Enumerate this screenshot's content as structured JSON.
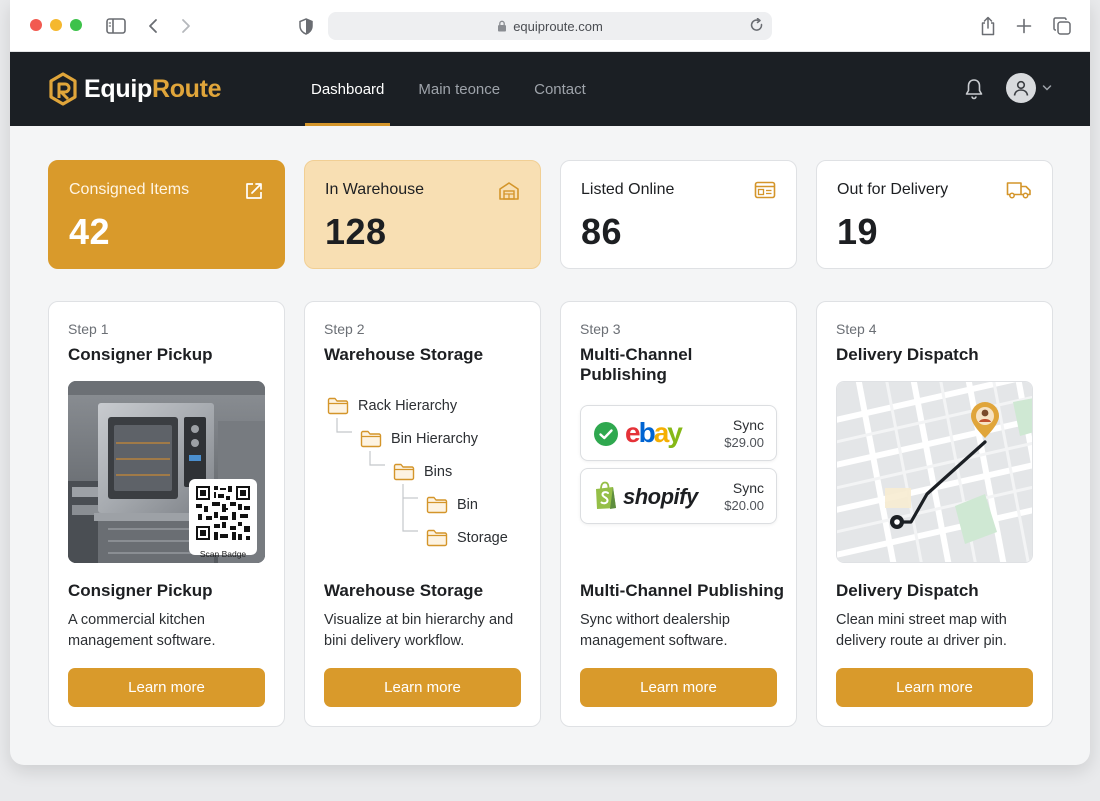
{
  "browser": {
    "url": "equiproute.com"
  },
  "brand": {
    "name_part1": "Equip",
    "name_part2": "Route"
  },
  "nav": {
    "links": [
      {
        "label": "Dashboard",
        "active": true
      },
      {
        "label": "Main teonce",
        "active": false
      },
      {
        "label": "Contact",
        "active": false
      }
    ]
  },
  "stats": [
    {
      "label": "Consigned Items",
      "value": "42",
      "icon": "external-link-icon"
    },
    {
      "label": "In Warehouse",
      "value": "128",
      "icon": "warehouse-icon"
    },
    {
      "label": "Listed Online",
      "value": "86",
      "icon": "listing-card-icon"
    },
    {
      "label": "Out for Delivery",
      "value": "19",
      "icon": "truck-icon"
    }
  ],
  "steps": [
    {
      "step": "Step 1",
      "header": "Consigner Pickup",
      "title": "Consigner Pickup",
      "desc": "A commercial kitchen management software.",
      "button": "Learn more",
      "badge_label": "Scan Badge"
    },
    {
      "step": "Step 2",
      "header": "Warehouse Storage",
      "title": "Warehouse Storage",
      "desc": "Visualize at bin hierarchy and bini delivery workflow.",
      "button": "Learn more",
      "tree": [
        "Rack Hierarchy",
        "Bin Hierarchy",
        "Bins",
        "Bin",
        "Storage"
      ]
    },
    {
      "step": "Step 3",
      "header": "Multi-Channel Publishing",
      "title": "Multi-Channel Publishing",
      "desc": "Sync withort dealership management software.",
      "button": "Learn more",
      "channels": [
        {
          "name": "ebay",
          "status": "Sync",
          "price": "$29.00"
        },
        {
          "name": "shopify",
          "status": "Sync",
          "price": "$20.00"
        }
      ]
    },
    {
      "step": "Step 4",
      "header": "Delivery Dispatch",
      "title": "Delivery Dispatch",
      "desc": "Clean mini street map with delivery route aı driver pin.",
      "button": "Learn more"
    }
  ],
  "colors": {
    "accent": "#d99a2b",
    "nav_bg": "#1b1f24",
    "accent_light": "#f8dfb3"
  }
}
